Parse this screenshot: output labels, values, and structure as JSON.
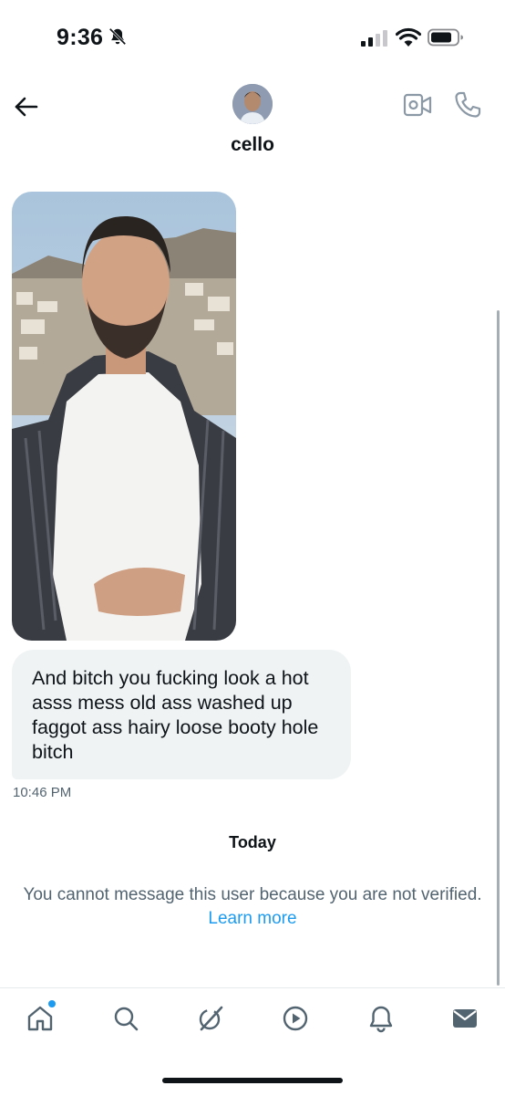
{
  "status_bar": {
    "time": "9:36",
    "icons": [
      "bell-off-icon",
      "signal-icon",
      "wifi-icon",
      "battery-icon"
    ]
  },
  "header": {
    "contact_name": "cello",
    "icons": [
      "back-arrow-icon",
      "avatar",
      "video-call-icon",
      "phone-call-icon"
    ]
  },
  "conversation": {
    "message_text": "And bitch you fucking look a hot asss mess old ass washed up faggot ass hairy loose booty hole bitch",
    "message_time": "10:46 PM",
    "day_separator": "Today",
    "notice_text": "You cannot message this user because you are not verified.",
    "notice_link": "Learn more"
  },
  "tab_bar": {
    "tabs": [
      "home-icon",
      "search-icon",
      "grok-icon",
      "video-icon",
      "notifications-icon",
      "messages-icon"
    ],
    "home_has_badge": true
  },
  "colors": {
    "text": "#0f1419",
    "secondary_text": "#536471",
    "link": "#1d9bf0",
    "bubble_bg": "#eff3f4"
  }
}
